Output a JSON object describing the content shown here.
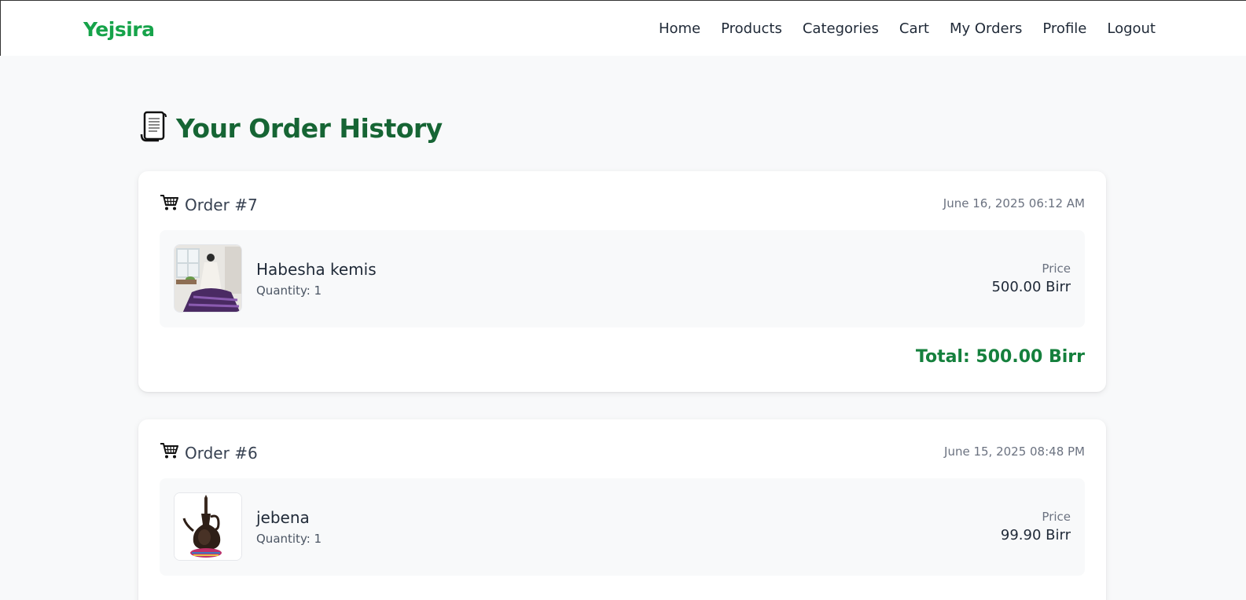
{
  "navbar": {
    "brand": "Yejsira",
    "links": [
      "Home",
      "Products",
      "Categories",
      "Cart",
      "My Orders",
      "Profile",
      "Logout"
    ]
  },
  "page": {
    "title": "Your Order History",
    "title_icon": "scroll-icon"
  },
  "labels": {
    "price": "Price"
  },
  "orders": [
    {
      "title": "Order #7",
      "icon": "cart-icon",
      "date": "June 16, 2025 06:12 AM",
      "items": [
        {
          "name": "Habesha kemis",
          "quantity": "Quantity: 1",
          "price": "500.00 Birr",
          "image": "habesha-kemis-dress"
        }
      ],
      "total": "Total: 500.00 Birr"
    },
    {
      "title": "Order #6",
      "icon": "cart-icon",
      "date": "June 15, 2025 08:48 PM",
      "items": [
        {
          "name": "jebena",
          "quantity": "Quantity: 1",
          "price": "99.90 Birr",
          "image": "jebena-coffee-pot"
        }
      ]
    }
  ],
  "colors": {
    "brand": "#16a34a",
    "heading": "#166534",
    "total": "#15803d",
    "background": "#f8f9fa"
  }
}
